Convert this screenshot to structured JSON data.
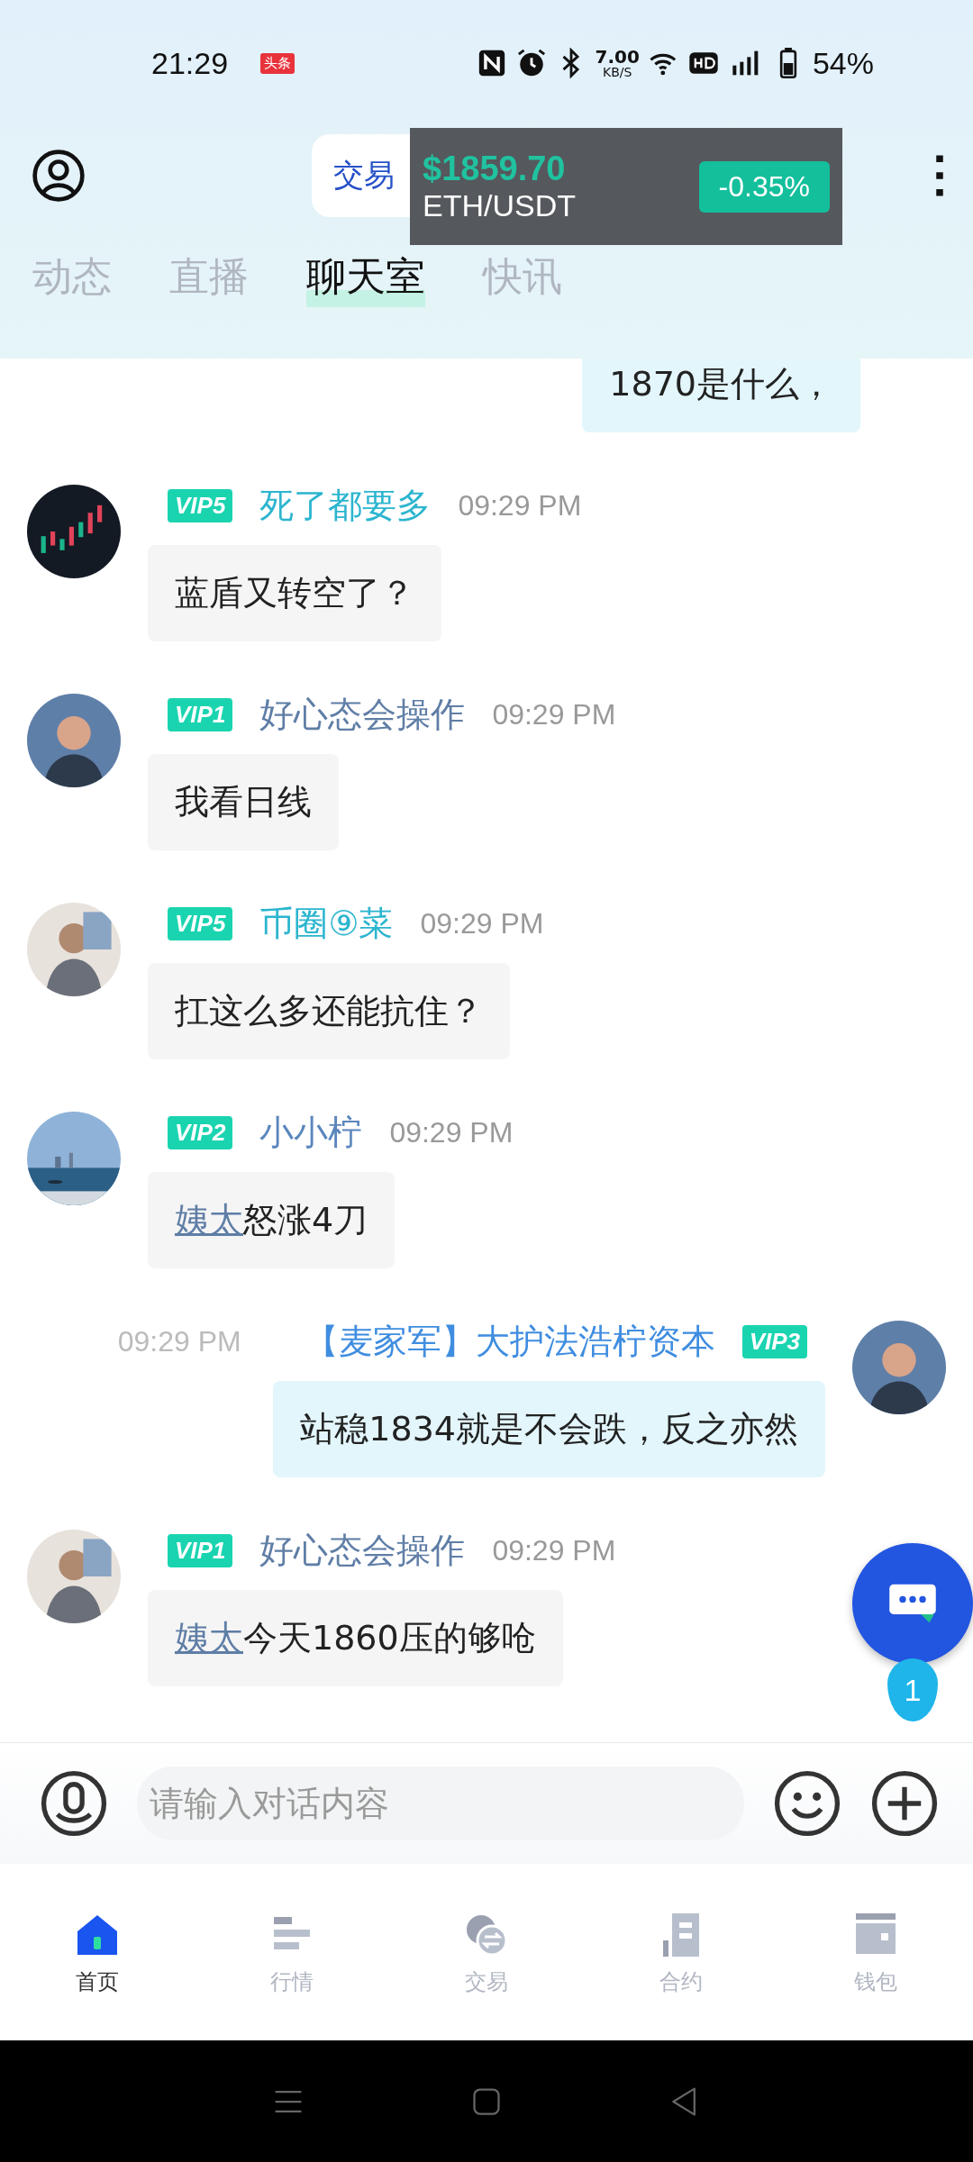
{
  "status_bar": {
    "time": "21:29",
    "app_badge": "头条",
    "speed": "7.00",
    "speed_unit": "KB/S",
    "battery": "54%"
  },
  "header": {
    "tabs": [
      {
        "label": "交易",
        "selected": true
      }
    ]
  },
  "ticker": {
    "price": "$1859.70",
    "pair": "ETH/USDT",
    "change": "-0.35%"
  },
  "tabs": [
    {
      "label": "动态",
      "selected": false
    },
    {
      "label": "直播",
      "selected": false
    },
    {
      "label": "聊天室",
      "selected": true
    },
    {
      "label": "快讯",
      "selected": false
    }
  ],
  "messages": [
    {
      "kind": "self",
      "text": "1870是什么，"
    },
    {
      "kind": "other",
      "vip": "VIP5",
      "name": "死了都要多",
      "color": "#2cb5cf",
      "time": "09:29 PM",
      "text": "蓝盾又转空了？"
    },
    {
      "kind": "other",
      "vip": "VIP1",
      "name": "好心态会操作",
      "color": "#5f7ea6",
      "time": "09:29 PM",
      "text": "我看日线"
    },
    {
      "kind": "other",
      "vip": "VIP5",
      "name": "币圈⑨菜",
      "color": "#2cb5cf",
      "time": "09:29 PM",
      "text": "扛这么多还能抗住？"
    },
    {
      "kind": "other",
      "vip": "VIP2",
      "name": "小小柠",
      "color": "#5a86bc",
      "time": "09:29 PM",
      "mention": "姨太",
      "text": "怒涨4刀"
    },
    {
      "kind": "self",
      "vip": "VIP3",
      "name": "【麦家军】大护法浩柠资本",
      "color": "#3f8de0",
      "time": "09:29 PM",
      "text": "站稳1834就是不会跌，反之亦然"
    },
    {
      "kind": "other",
      "vip": "VIP1",
      "name": "好心态会操作",
      "color": "#5f7ea6",
      "time": "09:29 PM",
      "mention": "姨太",
      "text": "今天1860压的够呛"
    }
  ],
  "unread": "1",
  "input": {
    "placeholder": "请输入对话内容"
  },
  "nav": [
    {
      "label": "首页",
      "selected": true
    },
    {
      "label": "行情",
      "selected": false
    },
    {
      "label": "交易",
      "selected": false
    },
    {
      "label": "合约",
      "selected": false
    },
    {
      "label": "钱包",
      "selected": false
    }
  ]
}
